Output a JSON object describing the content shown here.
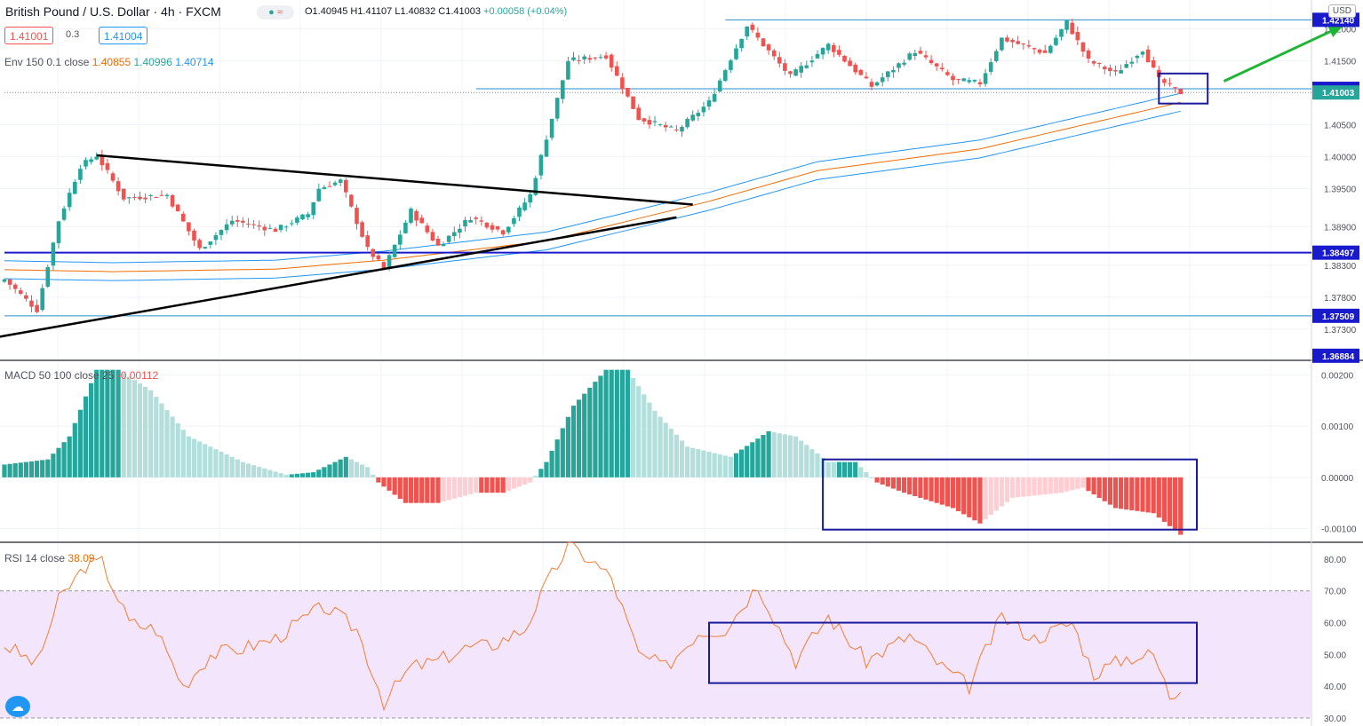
{
  "header": {
    "title": "British Pound / U.S. Dollar · 4h · FXCM",
    "ohlc_prefix": "O1.40945 H1.41107 L1.40832 C1.41003",
    "change": "+0.00058 (+0.04%)",
    "sell_price": "1.41001",
    "spread": "0.3",
    "buy_price": "1.41004",
    "currency": "USD"
  },
  "indicators": {
    "envelope": {
      "label": "Env 150 0.1 close",
      "basis": "1.40855",
      "upper": "1.40996",
      "lower": "1.40714"
    },
    "macd": {
      "label": "MACD 50 100 close 25",
      "value": "-0.00112"
    },
    "rsi": {
      "label": "RSI 14 close",
      "value": "38.09"
    }
  },
  "colors": {
    "bull": "#26a69a",
    "bear": "#ef5350",
    "bull_light": "#b2dfdb",
    "bear_light": "#ffcdd2",
    "envelope_mid": "#ef6c00",
    "envelope_band": "#2196f3",
    "rsi_line": "#f57c33",
    "rsi_band": "#f3e5fb",
    "level_blue": "#1a1acd",
    "trendline": "#000000",
    "arrow": "#1fb534",
    "annotation_box": "#1a1a9c"
  },
  "chart_data": [
    {
      "type": "candlestick",
      "title": "British Pound / U.S. Dollar · 4h · FXCM",
      "ylim": [
        1.3684,
        1.4245
      ],
      "yticks": [
        "1.37300",
        "1.37800",
        "1.38300",
        "1.38900",
        "1.39500",
        "1.40000",
        "1.40500",
        "1.41500",
        "1.42000"
      ],
      "price_labels": [
        {
          "value": "1.42140",
          "style": "filled"
        },
        {
          "value": "1.41061",
          "style": "filled"
        },
        {
          "value": "1.41003",
          "style": "filled-green"
        },
        {
          "value": "1.38497",
          "style": "filled"
        },
        {
          "value": "1.37509",
          "style": "filled"
        },
        {
          "value": "1.36884",
          "style": "filled"
        }
      ],
      "anchors": [
        {
          "bar": 0,
          "price": 1.3808
        },
        {
          "bar": 6,
          "price": 1.376
        },
        {
          "bar": 10,
          "price": 1.39
        },
        {
          "bar": 14,
          "price": 1.3985
        },
        {
          "bar": 17,
          "price": 1.4002
        },
        {
          "bar": 22,
          "price": 1.3935
        },
        {
          "bar": 30,
          "price": 1.394
        },
        {
          "bar": 36,
          "price": 1.3855
        },
        {
          "bar": 42,
          "price": 1.39
        },
        {
          "bar": 50,
          "price": 1.3885
        },
        {
          "bar": 56,
          "price": 1.391
        },
        {
          "bar": 58,
          "price": 1.395
        },
        {
          "bar": 62,
          "price": 1.3962
        },
        {
          "bar": 67,
          "price": 1.3855
        },
        {
          "bar": 70,
          "price": 1.3825
        },
        {
          "bar": 75,
          "price": 1.3915
        },
        {
          "bar": 80,
          "price": 1.386
        },
        {
          "bar": 86,
          "price": 1.3905
        },
        {
          "bar": 92,
          "price": 1.3882
        },
        {
          "bar": 97,
          "price": 1.394
        },
        {
          "bar": 101,
          "price": 1.406
        },
        {
          "bar": 104,
          "price": 1.415
        },
        {
          "bar": 111,
          "price": 1.4158
        },
        {
          "bar": 117,
          "price": 1.406
        },
        {
          "bar": 124,
          "price": 1.404
        },
        {
          "bar": 130,
          "price": 1.4085
        },
        {
          "bar": 137,
          "price": 1.4205
        },
        {
          "bar": 145,
          "price": 1.4125
        },
        {
          "bar": 152,
          "price": 1.4175
        },
        {
          "bar": 160,
          "price": 1.411
        },
        {
          "bar": 168,
          "price": 1.4165
        },
        {
          "bar": 175,
          "price": 1.412
        },
        {
          "bar": 180,
          "price": 1.4115
        },
        {
          "bar": 184,
          "price": 1.4185
        },
        {
          "bar": 192,
          "price": 1.4162
        },
        {
          "bar": 196,
          "price": 1.421
        },
        {
          "bar": 200,
          "price": 1.415
        },
        {
          "bar": 205,
          "price": 1.413
        },
        {
          "bar": 210,
          "price": 1.4168
        },
        {
          "bar": 213,
          "price": 1.412
        },
        {
          "bar": 217,
          "price": 1.41
        }
      ],
      "envelope": {
        "basis": [
          {
            "bar": 0,
            "price": 1.3823
          },
          {
            "bar": 20,
            "price": 1.382
          },
          {
            "bar": 50,
            "price": 1.3824
          },
          {
            "bar": 70,
            "price": 1.3838
          },
          {
            "bar": 100,
            "price": 1.3868
          },
          {
            "bar": 130,
            "price": 1.393
          },
          {
            "bar": 150,
            "price": 1.3978
          },
          {
            "bar": 180,
            "price": 1.4012
          },
          {
            "bar": 217,
            "price": 1.4085
          }
        ],
        "band_width": 0.0014
      },
      "horizontal_levels": [
        {
          "price": 1.4214,
          "from_bar": 133,
          "weight": "thin"
        },
        {
          "price": 1.41061,
          "from_bar": 87,
          "weight": "thin"
        },
        {
          "price": 1.41003,
          "from_bar": 0,
          "weight": "dotted"
        },
        {
          "price": 1.38497,
          "from_bar": 0,
          "weight": "thick"
        },
        {
          "price": 1.37509,
          "from_bar": 0,
          "weight": "thin"
        }
      ],
      "trendlines": [
        {
          "from": {
            "bar": 17,
            "price": 1.4002
          },
          "to": {
            "bar": 127,
            "price": 1.3925
          }
        },
        {
          "from": {
            "bar": -1,
            "price": 1.3718
          },
          "to": {
            "bar": 124,
            "price": 1.3905
          }
        }
      ],
      "annotations": [
        {
          "kind": "box",
          "bar_from": 213,
          "bar_to": 222,
          "price_from": 1.4083,
          "price_to": 1.413
        },
        {
          "kind": "arrow",
          "from": {
            "bar": 225,
            "price": 1.4118
          },
          "to": {
            "bar": 247,
            "price": 1.4205
          }
        }
      ]
    },
    {
      "type": "bar",
      "title": "MACD 50 100 close 25",
      "ylim": [
        -0.00125,
        0.00225
      ],
      "yticks": [
        "0.00200",
        "0.00100",
        "0.00000",
        "-0.00100"
      ],
      "anchors": [
        {
          "bar": 0,
          "value": 0.00025
        },
        {
          "bar": 8,
          "value": 0.00035
        },
        {
          "bar": 12,
          "value": 0.0008
        },
        {
          "bar": 17,
          "value": 0.0021
        },
        {
          "bar": 21,
          "value": 0.0021
        },
        {
          "bar": 27,
          "value": 0.0017
        },
        {
          "bar": 34,
          "value": 0.0008
        },
        {
          "bar": 44,
          "value": 0.0003
        },
        {
          "bar": 52,
          "value": 5e-05
        },
        {
          "bar": 57,
          "value": 0.0001
        },
        {
          "bar": 63,
          "value": 0.0004
        },
        {
          "bar": 67,
          "value": 0.0002
        },
        {
          "bar": 69,
          "value": -0.0001
        },
        {
          "bar": 74,
          "value": -0.0005
        },
        {
          "bar": 80,
          "value": -0.0005
        },
        {
          "bar": 87,
          "value": -0.0003
        },
        {
          "bar": 92,
          "value": -0.0003
        },
        {
          "bar": 97,
          "value": -0.0001
        },
        {
          "bar": 100,
          "value": 0.0003
        },
        {
          "bar": 105,
          "value": 0.0014
        },
        {
          "bar": 111,
          "value": 0.0021
        },
        {
          "bar": 115,
          "value": 0.0021
        },
        {
          "bar": 120,
          "value": 0.0013
        },
        {
          "bar": 126,
          "value": 0.0006
        },
        {
          "bar": 134,
          "value": 0.0004
        },
        {
          "bar": 141,
          "value": 0.0009
        },
        {
          "bar": 146,
          "value": 0.0008
        },
        {
          "bar": 152,
          "value": 0.0003
        },
        {
          "bar": 157,
          "value": 0.0003
        },
        {
          "bar": 161,
          "value": -0.0001
        },
        {
          "bar": 166,
          "value": -0.0003
        },
        {
          "bar": 175,
          "value": -0.0006
        },
        {
          "bar": 180,
          "value": -0.0009
        },
        {
          "bar": 186,
          "value": -0.0004
        },
        {
          "bar": 195,
          "value": -0.0003
        },
        {
          "bar": 199,
          "value": -0.0002
        },
        {
          "bar": 205,
          "value": -0.0006
        },
        {
          "bar": 212,
          "value": -0.0007
        },
        {
          "bar": 217,
          "value": -0.00112
        }
      ],
      "annotations": [
        {
          "kind": "box",
          "bar_from": 151,
          "bar_to": 220,
          "value_from": -0.00102,
          "value_to": 0.00035
        }
      ]
    },
    {
      "type": "line",
      "title": "RSI 14 close",
      "ylim": [
        27.5,
        85
      ],
      "yticks": [
        "80.00",
        "70.00",
        "60.00",
        "50.00",
        "40.00",
        "30.00"
      ],
      "band": [
        30,
        70
      ],
      "anchors": [
        {
          "bar": 0,
          "value": 53
        },
        {
          "bar": 6,
          "value": 47
        },
        {
          "bar": 10,
          "value": 67
        },
        {
          "bar": 15,
          "value": 78
        },
        {
          "bar": 18,
          "value": 79
        },
        {
          "bar": 23,
          "value": 60
        },
        {
          "bar": 28,
          "value": 58
        },
        {
          "bar": 33,
          "value": 40
        },
        {
          "bar": 38,
          "value": 50
        },
        {
          "bar": 44,
          "value": 52
        },
        {
          "bar": 50,
          "value": 55
        },
        {
          "bar": 56,
          "value": 62
        },
        {
          "bar": 59,
          "value": 65
        },
        {
          "bar": 65,
          "value": 58
        },
        {
          "bar": 70,
          "value": 35
        },
        {
          "bar": 75,
          "value": 46
        },
        {
          "bar": 80,
          "value": 48
        },
        {
          "bar": 85,
          "value": 52
        },
        {
          "bar": 90,
          "value": 53
        },
        {
          "bar": 96,
          "value": 58
        },
        {
          "bar": 100,
          "value": 72
        },
        {
          "bar": 104,
          "value": 84
        },
        {
          "bar": 108,
          "value": 80
        },
        {
          "bar": 112,
          "value": 74
        },
        {
          "bar": 117,
          "value": 50
        },
        {
          "bar": 122,
          "value": 46
        },
        {
          "bar": 128,
          "value": 57
        },
        {
          "bar": 133,
          "value": 58
        },
        {
          "bar": 139,
          "value": 72
        },
        {
          "bar": 146,
          "value": 48
        },
        {
          "bar": 152,
          "value": 62
        },
        {
          "bar": 159,
          "value": 48
        },
        {
          "bar": 167,
          "value": 56
        },
        {
          "bar": 173,
          "value": 46
        },
        {
          "bar": 178,
          "value": 40
        },
        {
          "bar": 184,
          "value": 62
        },
        {
          "bar": 190,
          "value": 55
        },
        {
          "bar": 197,
          "value": 60
        },
        {
          "bar": 201,
          "value": 44
        },
        {
          "bar": 207,
          "value": 49
        },
        {
          "bar": 212,
          "value": 50
        },
        {
          "bar": 215,
          "value": 37
        },
        {
          "bar": 217,
          "value": 38.09
        }
      ],
      "annotations": [
        {
          "kind": "box",
          "bar_from": 130,
          "bar_to": 220,
          "value_from": 41,
          "value_to": 60
        }
      ]
    }
  ]
}
